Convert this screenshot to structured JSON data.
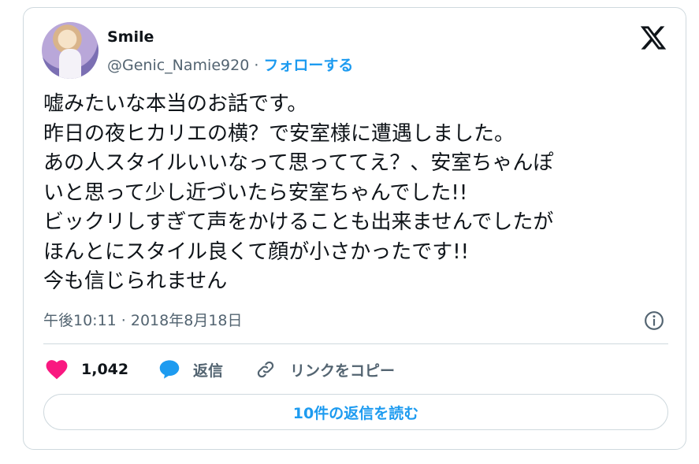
{
  "tweet": {
    "author": {
      "display_name": "Smile",
      "handle": "@Genic_Namie920",
      "separator": "·",
      "follow_label": "フォローする"
    },
    "body_lines": [
      "嘘みたいな本当のお話です。",
      "昨日の夜ヒカリエの横？で安室様に遭遇しました。",
      "あの人スタイルいいなって思っててえ？、安室ちゃんぽ",
      "いと思って少し近づいたら安室ちゃんでした!!",
      "ビックリしすぎて声をかけることも出来ませんでしたが",
      "ほんとにスタイル良くて顔が小さかったです!!",
      "今も信じられません"
    ],
    "timestamp": "午後10:11 · 2018年8月18日",
    "actions": {
      "like_count": "1,042",
      "reply_label": "返信",
      "copy_link_label": "リンクをコピー"
    },
    "read_replies_label": "10件の返信を読む"
  },
  "icons": {
    "logo": "x-logo-icon",
    "info": "info-icon",
    "like": "heart-icon",
    "reply": "reply-bubble-icon",
    "link": "link-icon"
  },
  "colors": {
    "accent": "#1d9bf0",
    "like": "#f91880",
    "text": "#0f1419",
    "secondary": "#536471",
    "border": "#cfd9de"
  }
}
